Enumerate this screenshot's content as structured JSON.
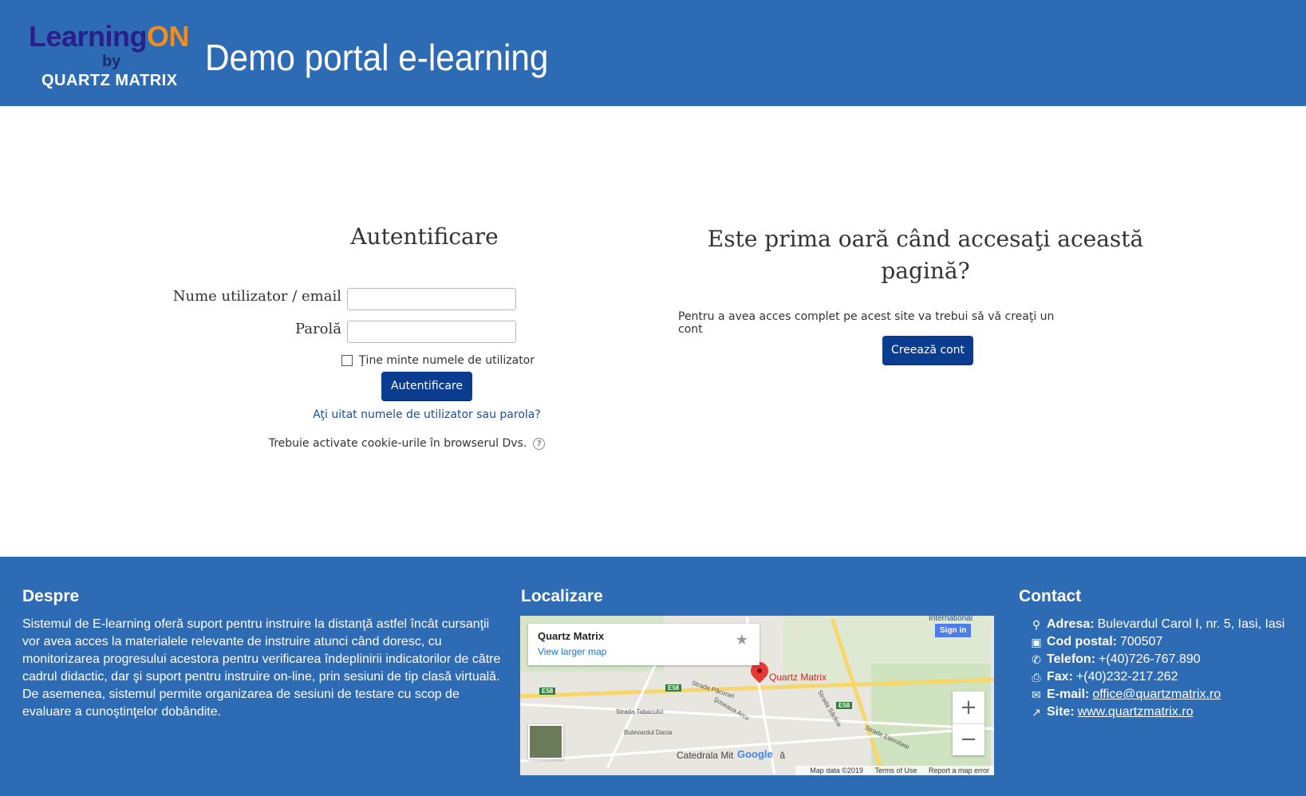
{
  "header": {
    "logo": {
      "learning": "LearningON",
      "by": "by",
      "company": "QUARTZ MATRIX"
    },
    "title": "Demo portal e-learning",
    "bg_color": "#2e6bb5"
  },
  "login": {
    "title": "Autentificare",
    "username_label": "Nume utilizator / email",
    "username_value": "",
    "password_label": "Parolă",
    "password_value": "",
    "remember_label": "Ţine minte numele de utilizator",
    "submit_label": "Autentificare",
    "forgot_link": "Aţi uitat numele de utilizator sau parola?",
    "cookies_text": "Trebuie activate cookie-urile în browserul Dvs.",
    "help_icon": "question-circle-icon"
  },
  "first_time": {
    "title": "Este prima oară când accesaţi această pagină?",
    "text": "Pentru a avea acces complet pe acest site va trebui să vă creaţi un cont",
    "create_label": "Creează cont"
  },
  "footer": {
    "about": {
      "heading": "Despre",
      "text": "Sistemul de E-learning oferă suport pentru instruire la distanţă astfel încât cursanţii vor avea acces la materialele relevante de instruire atunci când doresc, cu monitorizarea progresului acestora pentru verificarea îndeplinirii indicatorilor de către cadrul didactic, dar şi suport pentru instruire on-line, prin sesiuni de tip clasă virtuală. De asemenea, sistemul permite organizarea de sesiuni de testare cu scop de evaluare a cunoştinţelor dobândite."
    },
    "location": {
      "heading": "Localizare",
      "map": {
        "place_name": "Quartz Matrix",
        "view_larger": "View larger map",
        "sign_in": "Sign in",
        "international": "International",
        "pin_label": "Quartz Matrix",
        "landmark": "Catedrala Mit",
        "landmark_suffix": "ă",
        "google": "Google",
        "map_data": "Map data ©2019",
        "terms": "Terms of Use",
        "report": "Report a map error",
        "streets": [
          "Strada Păcurari",
          "Şoseaua Arcu",
          "Strada Tabacului",
          "Bulevardul Dacia",
          "Strada Sărărie",
          "Strada Eternitate"
        ],
        "shields": [
          "E58",
          "E58",
          "E58"
        ],
        "zoom_in": "+",
        "zoom_out": "−"
      }
    },
    "contact": {
      "heading": "Contact",
      "rows": [
        {
          "icon": "map-marker-icon",
          "label": "Adresa:",
          "value": "Bulevardul Carol I, nr. 5, Iasi, Iasi"
        },
        {
          "icon": "address-card-icon",
          "label": "Cod postal:",
          "value": "700507"
        },
        {
          "icon": "phone-icon",
          "label": "Telefon:",
          "value": "+(40)726-767.890"
        },
        {
          "icon": "fax-icon",
          "label": "Fax:",
          "value": "+(40)232-217.262"
        },
        {
          "icon": "envelope-icon",
          "label": "E-mail:",
          "value": "office@quartzmatrix.ro"
        },
        {
          "icon": "external-link-icon",
          "label": "Site:",
          "value": "www.quartzmatrix.ro"
        }
      ]
    }
  }
}
